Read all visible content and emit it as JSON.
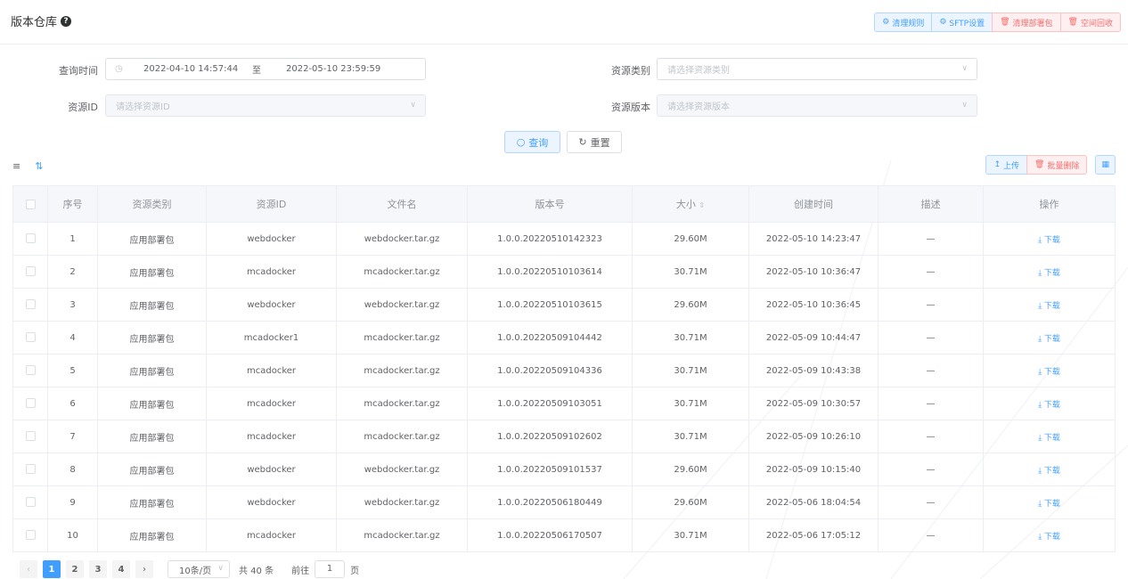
{
  "header": {
    "title": "版本仓库",
    "buttons": [
      {
        "label": "清理规则",
        "icon": "gear-icon",
        "style": "blue"
      },
      {
        "label": "SFTP设置",
        "icon": "gears-icon",
        "style": "blue"
      },
      {
        "label": "清理部署包",
        "icon": "trash-icon",
        "style": "red"
      },
      {
        "label": "空间回收",
        "icon": "trash-icon",
        "style": "red"
      }
    ]
  },
  "search": {
    "time_label": "查询时间",
    "start_time": "2022-04-10 14:57:44",
    "separator": "至",
    "end_time": "2022-05-10 23:59:59",
    "type_label": "资源类别",
    "type_placeholder": "请选择资源类别",
    "id_label": "资源ID",
    "id_placeholder": "请选择资源ID",
    "version_label": "资源版本",
    "version_placeholder": "请选择资源版本",
    "query_label": "查询",
    "reset_label": "重置"
  },
  "toolbar": {
    "upload_label": "上传",
    "batch_delete_label": "批量删除"
  },
  "table": {
    "columns": [
      "序号",
      "资源类别",
      "资源ID",
      "文件名",
      "版本号",
      "大小",
      "创建时间",
      "描述",
      "操作"
    ],
    "download_label": "下载",
    "rows": [
      {
        "no": "1",
        "type": "应用部署包",
        "id": "webdocker",
        "file": "webdocker.tar.gz",
        "version": "1.0.0.20220510142323",
        "size": "29.60M",
        "created": "2022-05-10 14:23:47",
        "desc": "—"
      },
      {
        "no": "2",
        "type": "应用部署包",
        "id": "mcadocker",
        "file": "mcadocker.tar.gz",
        "version": "1.0.0.20220510103614",
        "size": "30.71M",
        "created": "2022-05-10 10:36:47",
        "desc": "—"
      },
      {
        "no": "3",
        "type": "应用部署包",
        "id": "webdocker",
        "file": "webdocker.tar.gz",
        "version": "1.0.0.20220510103615",
        "size": "29.60M",
        "created": "2022-05-10 10:36:45",
        "desc": "—"
      },
      {
        "no": "4",
        "type": "应用部署包",
        "id": "mcadocker1",
        "file": "mcadocker.tar.gz",
        "version": "1.0.0.20220509104442",
        "size": "30.71M",
        "created": "2022-05-09 10:44:47",
        "desc": "—"
      },
      {
        "no": "5",
        "type": "应用部署包",
        "id": "mcadocker",
        "file": "mcadocker.tar.gz",
        "version": "1.0.0.20220509104336",
        "size": "30.71M",
        "created": "2022-05-09 10:43:38",
        "desc": "—"
      },
      {
        "no": "6",
        "type": "应用部署包",
        "id": "mcadocker",
        "file": "mcadocker.tar.gz",
        "version": "1.0.0.20220509103051",
        "size": "30.71M",
        "created": "2022-05-09 10:30:57",
        "desc": "—"
      },
      {
        "no": "7",
        "type": "应用部署包",
        "id": "mcadocker",
        "file": "mcadocker.tar.gz",
        "version": "1.0.0.20220509102602",
        "size": "30.71M",
        "created": "2022-05-09 10:26:10",
        "desc": "—"
      },
      {
        "no": "8",
        "type": "应用部署包",
        "id": "webdocker",
        "file": "webdocker.tar.gz",
        "version": "1.0.0.20220509101537",
        "size": "29.60M",
        "created": "2022-05-09 10:15:40",
        "desc": "—"
      },
      {
        "no": "9",
        "type": "应用部署包",
        "id": "webdocker",
        "file": "webdocker.tar.gz",
        "version": "1.0.0.20220506180449",
        "size": "29.60M",
        "created": "2022-05-06 18:04:54",
        "desc": "—"
      },
      {
        "no": "10",
        "type": "应用部署包",
        "id": "mcadocker",
        "file": "mcadocker.tar.gz",
        "version": "1.0.0.20220506170507",
        "size": "30.71M",
        "created": "2022-05-06 17:05:12",
        "desc": "—"
      }
    ]
  },
  "pagination": {
    "pages": [
      "1",
      "2",
      "3",
      "4"
    ],
    "current": "1",
    "page_size": "10条/页",
    "total": "共 40 条",
    "goto_label": "前往",
    "goto_value": "1",
    "page_suffix": "页"
  },
  "colors": {
    "primary": "#409eff",
    "danger": "#f56c6c",
    "header_bg": "#f5f7fa"
  }
}
